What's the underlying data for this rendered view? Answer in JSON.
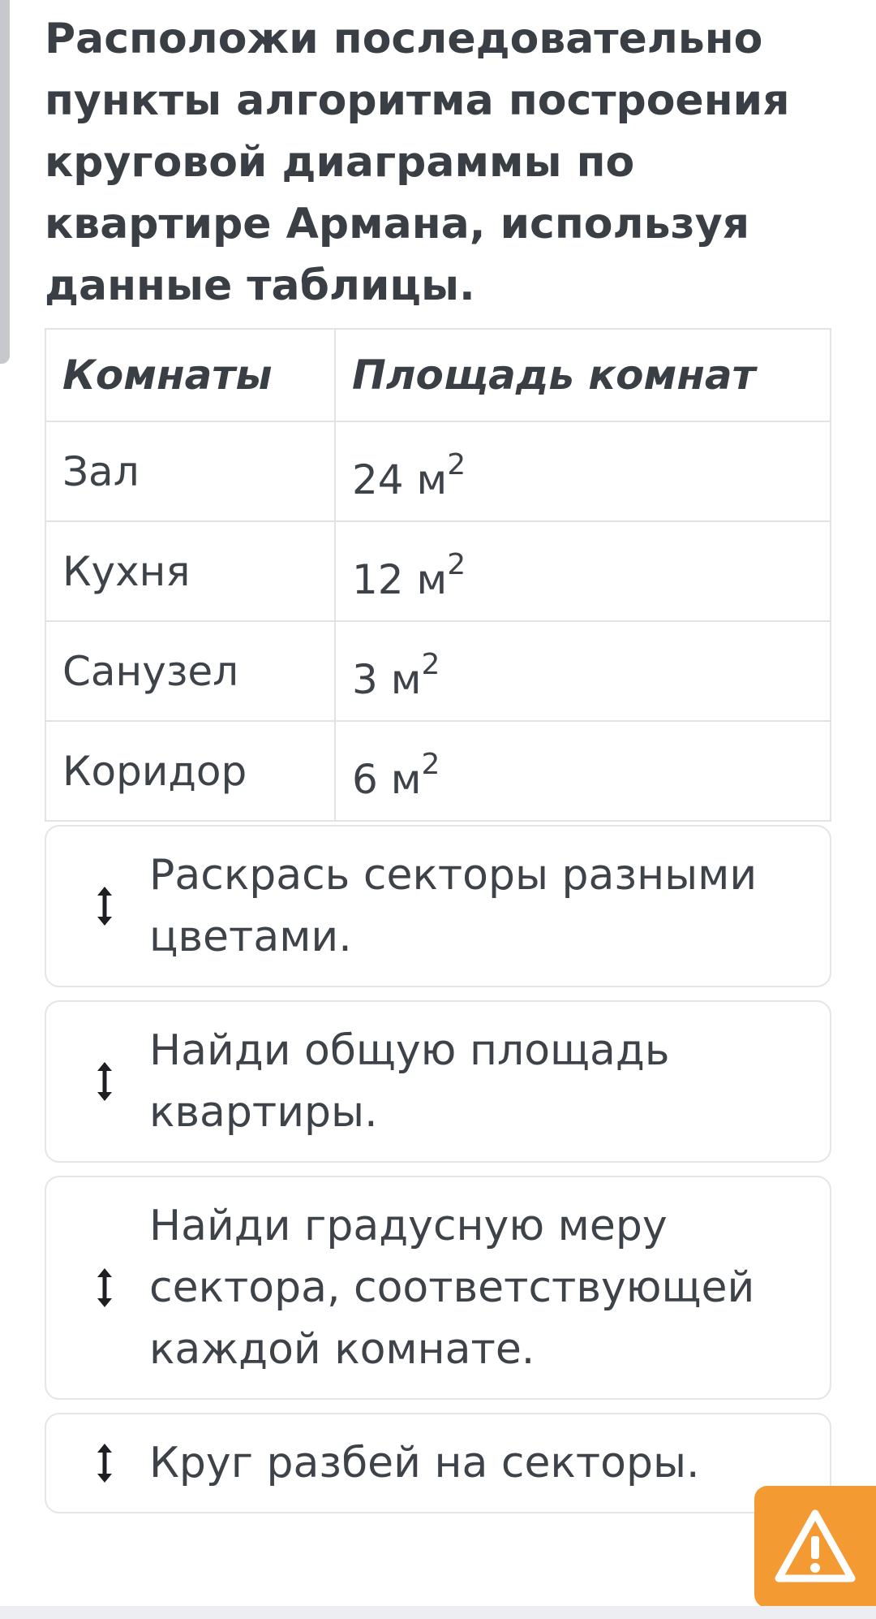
{
  "question": "Расположи последовательно пункты алгоритма построения круговой диаграммы по квартире Армана, используя данные таблицы.",
  "table": {
    "headers": [
      "Комнаты",
      "Площадь комнат"
    ],
    "rows": [
      {
        "room": "Зал",
        "value": "24 м",
        "exp": "2"
      },
      {
        "room": "Кухня",
        "value": "12 м",
        "exp": "2"
      },
      {
        "room": "Санузел",
        "value": "3 м",
        "exp": "2"
      },
      {
        "room": "Коридор",
        "value": "6 м",
        "exp": "2"
      }
    ]
  },
  "steps": [
    "Раскрась секторы разными цветами.",
    "Найди общую площадь квартиры.",
    "Найди градусную меру сектора, соответствующей каждой комнате.",
    "Круг разбей на секторы."
  ],
  "icons": {
    "drag_handle": "vertical-drag-arrows-icon",
    "report": "warning-icon"
  },
  "colors": {
    "accent": "#f49a33",
    "text": "#3e434a",
    "border": "#e1e3e6"
  }
}
